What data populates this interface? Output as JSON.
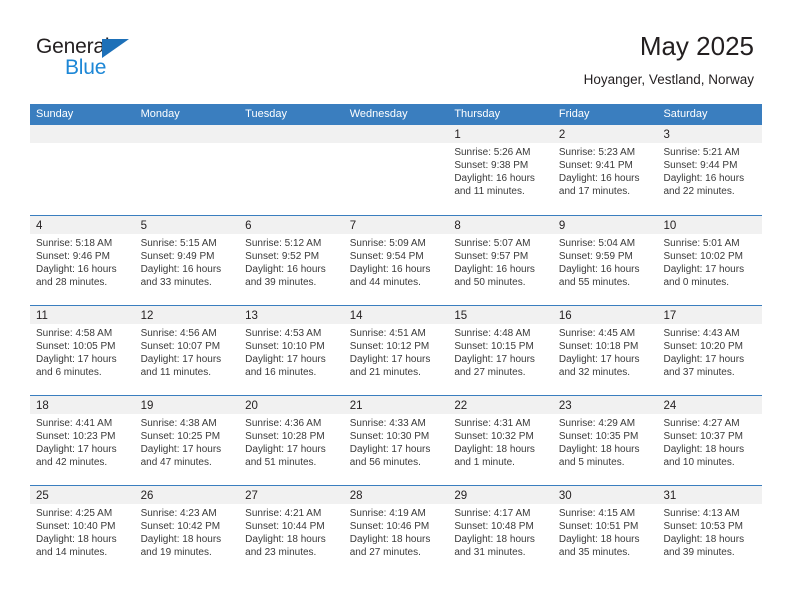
{
  "brand": {
    "line1": "General",
    "line2": "Blue",
    "triangle_icon": "triangle-icon",
    "color_dark": "#231f20",
    "color_blue": "#1d87d6"
  },
  "header": {
    "title": "May 2025",
    "subtitle": "Hoyanger, Vestland, Norway"
  },
  "theme": {
    "header_blue": "#3a7ebf",
    "day_strip_gray": "#f1f1f1",
    "text": "#231f20"
  },
  "calendar": {
    "weekdays": [
      "Sunday",
      "Monday",
      "Tuesday",
      "Wednesday",
      "Thursday",
      "Friday",
      "Saturday"
    ],
    "weeks": [
      [
        {
          "day": "",
          "lines": []
        },
        {
          "day": "",
          "lines": []
        },
        {
          "day": "",
          "lines": []
        },
        {
          "day": "",
          "lines": []
        },
        {
          "day": "1",
          "lines": [
            "Sunrise: 5:26 AM",
            "Sunset: 9:38 PM",
            "Daylight: 16 hours",
            "and 11 minutes."
          ]
        },
        {
          "day": "2",
          "lines": [
            "Sunrise: 5:23 AM",
            "Sunset: 9:41 PM",
            "Daylight: 16 hours",
            "and 17 minutes."
          ]
        },
        {
          "day": "3",
          "lines": [
            "Sunrise: 5:21 AM",
            "Sunset: 9:44 PM",
            "Daylight: 16 hours",
            "and 22 minutes."
          ]
        }
      ],
      [
        {
          "day": "4",
          "lines": [
            "Sunrise: 5:18 AM",
            "Sunset: 9:46 PM",
            "Daylight: 16 hours",
            "and 28 minutes."
          ]
        },
        {
          "day": "5",
          "lines": [
            "Sunrise: 5:15 AM",
            "Sunset: 9:49 PM",
            "Daylight: 16 hours",
            "and 33 minutes."
          ]
        },
        {
          "day": "6",
          "lines": [
            "Sunrise: 5:12 AM",
            "Sunset: 9:52 PM",
            "Daylight: 16 hours",
            "and 39 minutes."
          ]
        },
        {
          "day": "7",
          "lines": [
            "Sunrise: 5:09 AM",
            "Sunset: 9:54 PM",
            "Daylight: 16 hours",
            "and 44 minutes."
          ]
        },
        {
          "day": "8",
          "lines": [
            "Sunrise: 5:07 AM",
            "Sunset: 9:57 PM",
            "Daylight: 16 hours",
            "and 50 minutes."
          ]
        },
        {
          "day": "9",
          "lines": [
            "Sunrise: 5:04 AM",
            "Sunset: 9:59 PM",
            "Daylight: 16 hours",
            "and 55 minutes."
          ]
        },
        {
          "day": "10",
          "lines": [
            "Sunrise: 5:01 AM",
            "Sunset: 10:02 PM",
            "Daylight: 17 hours",
            "and 0 minutes."
          ]
        }
      ],
      [
        {
          "day": "11",
          "lines": [
            "Sunrise: 4:58 AM",
            "Sunset: 10:05 PM",
            "Daylight: 17 hours",
            "and 6 minutes."
          ]
        },
        {
          "day": "12",
          "lines": [
            "Sunrise: 4:56 AM",
            "Sunset: 10:07 PM",
            "Daylight: 17 hours",
            "and 11 minutes."
          ]
        },
        {
          "day": "13",
          "lines": [
            "Sunrise: 4:53 AM",
            "Sunset: 10:10 PM",
            "Daylight: 17 hours",
            "and 16 minutes."
          ]
        },
        {
          "day": "14",
          "lines": [
            "Sunrise: 4:51 AM",
            "Sunset: 10:12 PM",
            "Daylight: 17 hours",
            "and 21 minutes."
          ]
        },
        {
          "day": "15",
          "lines": [
            "Sunrise: 4:48 AM",
            "Sunset: 10:15 PM",
            "Daylight: 17 hours",
            "and 27 minutes."
          ]
        },
        {
          "day": "16",
          "lines": [
            "Sunrise: 4:45 AM",
            "Sunset: 10:18 PM",
            "Daylight: 17 hours",
            "and 32 minutes."
          ]
        },
        {
          "day": "17",
          "lines": [
            "Sunrise: 4:43 AM",
            "Sunset: 10:20 PM",
            "Daylight: 17 hours",
            "and 37 minutes."
          ]
        }
      ],
      [
        {
          "day": "18",
          "lines": [
            "Sunrise: 4:41 AM",
            "Sunset: 10:23 PM",
            "Daylight: 17 hours",
            "and 42 minutes."
          ]
        },
        {
          "day": "19",
          "lines": [
            "Sunrise: 4:38 AM",
            "Sunset: 10:25 PM",
            "Daylight: 17 hours",
            "and 47 minutes."
          ]
        },
        {
          "day": "20",
          "lines": [
            "Sunrise: 4:36 AM",
            "Sunset: 10:28 PM",
            "Daylight: 17 hours",
            "and 51 minutes."
          ]
        },
        {
          "day": "21",
          "lines": [
            "Sunrise: 4:33 AM",
            "Sunset: 10:30 PM",
            "Daylight: 17 hours",
            "and 56 minutes."
          ]
        },
        {
          "day": "22",
          "lines": [
            "Sunrise: 4:31 AM",
            "Sunset: 10:32 PM",
            "Daylight: 18 hours",
            "and 1 minute."
          ]
        },
        {
          "day": "23",
          "lines": [
            "Sunrise: 4:29 AM",
            "Sunset: 10:35 PM",
            "Daylight: 18 hours",
            "and 5 minutes."
          ]
        },
        {
          "day": "24",
          "lines": [
            "Sunrise: 4:27 AM",
            "Sunset: 10:37 PM",
            "Daylight: 18 hours",
            "and 10 minutes."
          ]
        }
      ],
      [
        {
          "day": "25",
          "lines": [
            "Sunrise: 4:25 AM",
            "Sunset: 10:40 PM",
            "Daylight: 18 hours",
            "and 14 minutes."
          ]
        },
        {
          "day": "26",
          "lines": [
            "Sunrise: 4:23 AM",
            "Sunset: 10:42 PM",
            "Daylight: 18 hours",
            "and 19 minutes."
          ]
        },
        {
          "day": "27",
          "lines": [
            "Sunrise: 4:21 AM",
            "Sunset: 10:44 PM",
            "Daylight: 18 hours",
            "and 23 minutes."
          ]
        },
        {
          "day": "28",
          "lines": [
            "Sunrise: 4:19 AM",
            "Sunset: 10:46 PM",
            "Daylight: 18 hours",
            "and 27 minutes."
          ]
        },
        {
          "day": "29",
          "lines": [
            "Sunrise: 4:17 AM",
            "Sunset: 10:48 PM",
            "Daylight: 18 hours",
            "and 31 minutes."
          ]
        },
        {
          "day": "30",
          "lines": [
            "Sunrise: 4:15 AM",
            "Sunset: 10:51 PM",
            "Daylight: 18 hours",
            "and 35 minutes."
          ]
        },
        {
          "day": "31",
          "lines": [
            "Sunrise: 4:13 AM",
            "Sunset: 10:53 PM",
            "Daylight: 18 hours",
            "and 39 minutes."
          ]
        }
      ]
    ]
  }
}
